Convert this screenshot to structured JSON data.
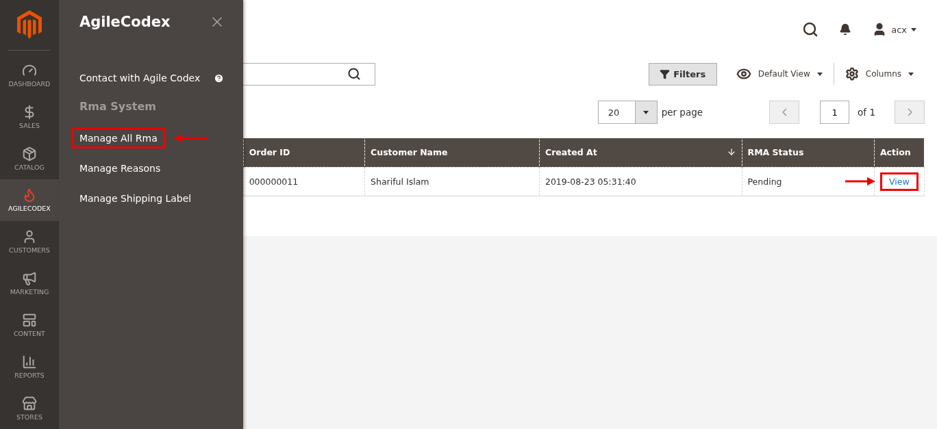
{
  "nav": [
    {
      "kind": "dashboard",
      "label": "DASHBOARD",
      "selected": false
    },
    {
      "kind": "sales",
      "label": "SALES",
      "selected": false
    },
    {
      "kind": "catalog",
      "label": "CATALOG",
      "selected": false
    },
    {
      "kind": "agilecodex",
      "label": "AGILECODEX",
      "selected": true
    },
    {
      "kind": "customers",
      "label": "CUSTOMERS",
      "selected": false
    },
    {
      "kind": "marketing",
      "label": "MARKETING",
      "selected": false
    },
    {
      "kind": "content",
      "label": "CONTENT",
      "selected": false
    },
    {
      "kind": "reports",
      "label": "REPORTS",
      "selected": false
    },
    {
      "kind": "stores",
      "label": "STORES",
      "selected": false
    }
  ],
  "flyout": {
    "title": "AgileCodex",
    "items": [
      {
        "kind": "link",
        "label": "Contact with Agile Codex",
        "help": true,
        "highlighted": false
      },
      {
        "kind": "heading",
        "label": "Rma System"
      },
      {
        "kind": "link",
        "label": "Manage All Rma",
        "help": false,
        "highlighted": true
      },
      {
        "kind": "link",
        "label": "Manage Reasons",
        "help": false,
        "highlighted": false
      },
      {
        "kind": "link",
        "label": "Manage Shipping Label",
        "help": false,
        "highlighted": false
      }
    ]
  },
  "header": {
    "user": "acx"
  },
  "toolbar": {
    "filters": "Filters",
    "view": "Default View",
    "columns": "Columns"
  },
  "pager": {
    "per_page_value": "20",
    "per_page_label": "per page",
    "page": "1",
    "of": "of 1"
  },
  "table": {
    "columns": [
      {
        "label": "Order ID",
        "sorted": false
      },
      {
        "label": "Customer Name",
        "sorted": false
      },
      {
        "label": "Created At",
        "sorted": true
      },
      {
        "label": "RMA Status",
        "sorted": false
      },
      {
        "label": "Action",
        "sorted": false
      }
    ],
    "rows": [
      {
        "order_id": "000000011",
        "customer": "Shariful Islam",
        "created": "2019-08-23 05:31:40",
        "status": "Pending",
        "action": "View",
        "highlighted": true
      }
    ]
  }
}
